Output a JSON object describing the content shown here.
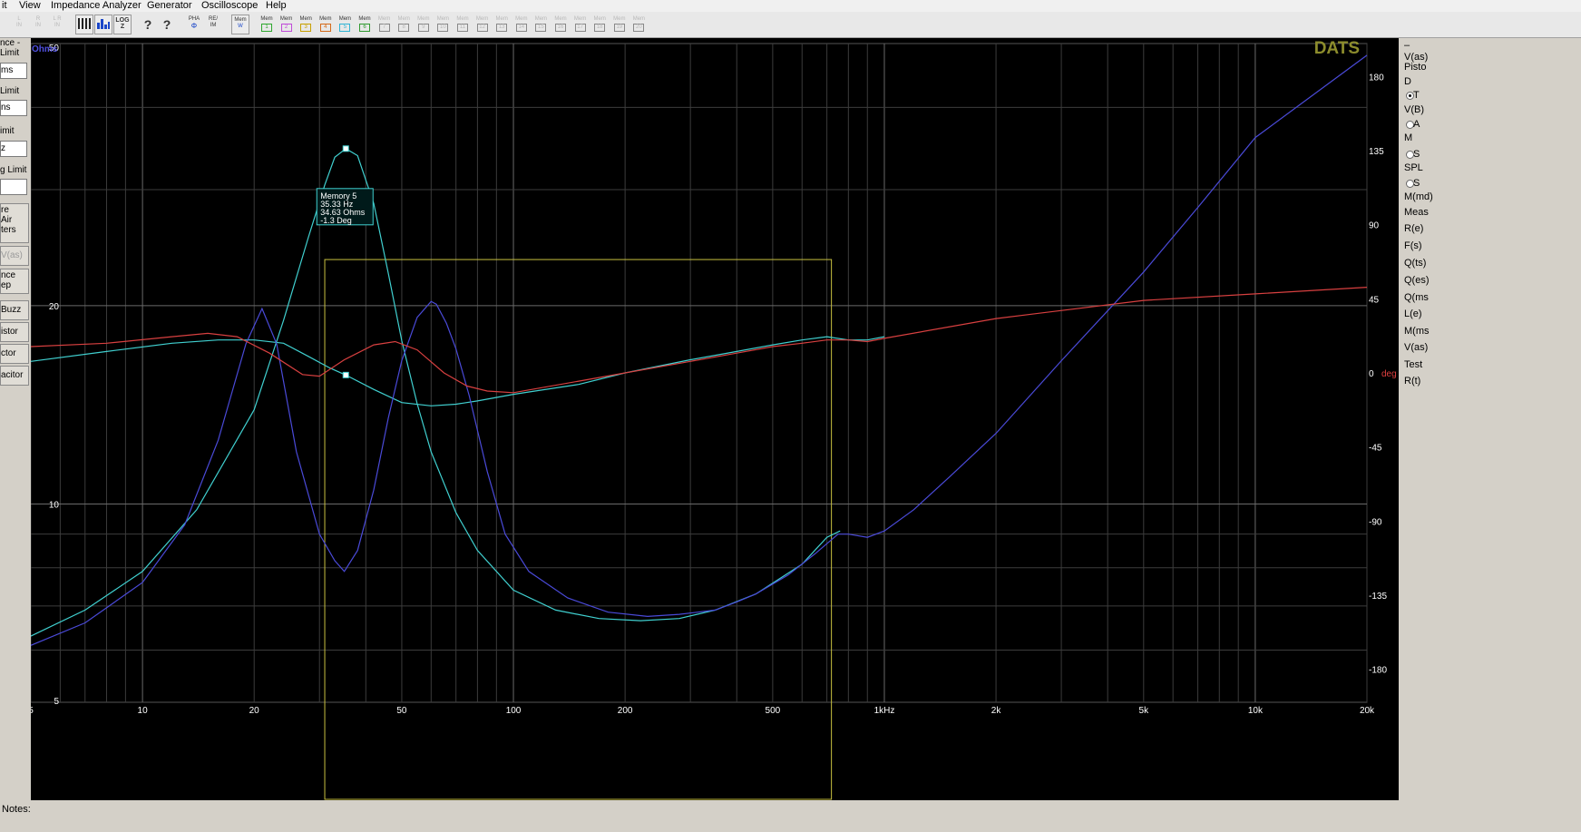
{
  "menu": [
    "it",
    "View",
    "Impedance Analyzer",
    "Generator",
    "Oscilloscope",
    "Help"
  ],
  "toolbar": {
    "channels": [
      {
        "t": "L",
        "b": "IN"
      },
      {
        "t": "R",
        "b": "IN"
      },
      {
        "t": "L R",
        "b": "IN"
      }
    ],
    "tools": [
      {
        "t": "LOG",
        "b": "Z"
      },
      {
        "t": "PHA",
        "b": "Φ"
      },
      {
        "t": "RE/",
        "b": "IM"
      },
      {
        "t": "Mem",
        "b": "W"
      }
    ],
    "mem_label": "Mem",
    "memories": [
      "1",
      "2",
      "3",
      "4",
      "5",
      "6",
      "7",
      "8",
      "9",
      "10",
      "11",
      "12",
      "13",
      "14",
      "15",
      "16",
      "17",
      "18",
      "19",
      "20"
    ]
  },
  "left_panel": {
    "labels": [
      "nce -",
      "Limit",
      "Limit",
      "imit",
      "g Limit"
    ],
    "boxes": [
      "ms",
      "ns",
      "z",
      ""
    ],
    "measure_lines": [
      "re",
      "Air",
      "ters"
    ],
    "buttons": [
      "V(as)",
      "nce",
      "ep",
      "Buzz",
      "istor",
      "ctor",
      "acitor"
    ]
  },
  "chart_data": {
    "type": "line",
    "brand": "DATS",
    "xscale": "log",
    "xlim": [
      5,
      20000
    ],
    "y_left": {
      "label": "Ohms",
      "scale": "log",
      "lim": [
        5,
        50
      ],
      "ticks": [
        5,
        10,
        20,
        50
      ]
    },
    "y_right": {
      "label": "deg",
      "lim": [
        -200,
        200
      ],
      "ticks": [
        180,
        135,
        90,
        45,
        0,
        -45,
        -90,
        -135,
        -180
      ]
    },
    "x_ticks": [
      {
        "v": 5,
        "label": "5"
      },
      {
        "v": 10,
        "label": "10"
      },
      {
        "v": 20,
        "label": "20"
      },
      {
        "v": 50,
        "label": "50"
      },
      {
        "v": 100,
        "label": "100"
      },
      {
        "v": 200,
        "label": "200"
      },
      {
        "v": 500,
        "label": "500"
      },
      {
        "v": 1000,
        "label": "1kHz"
      },
      {
        "v": 2000,
        "label": "2k"
      },
      {
        "v": 5000,
        "label": "5k"
      },
      {
        "v": 10000,
        "label": "10k"
      },
      {
        "v": 20000,
        "label": "20k"
      }
    ],
    "series": [
      {
        "color": "#40d0d0",
        "axis": "ohms",
        "x": [
          5,
          7,
          10,
          14,
          20,
          24,
          28,
          31,
          33,
          35.33,
          38,
          42,
          46,
          50,
          55,
          60,
          70,
          80,
          100,
          130,
          170,
          220,
          280,
          350,
          450,
          600,
          700,
          760
        ],
        "y": [
          6.3,
          6.9,
          7.9,
          9.8,
          13.9,
          19.0,
          25.4,
          30.5,
          33.6,
          34.63,
          33.8,
          28.6,
          22.4,
          17.7,
          14.2,
          12.0,
          9.7,
          8.5,
          7.4,
          6.9,
          6.7,
          6.65,
          6.7,
          6.9,
          7.3,
          8.1,
          8.9,
          9.1
        ]
      },
      {
        "color": "#40d0d0",
        "axis": "deg",
        "x": [
          5,
          8,
          12,
          16,
          20,
          24,
          28,
          32,
          35.33,
          42,
          50,
          60,
          70,
          80,
          100,
          150,
          200,
          300,
          400,
          500,
          600,
          700,
          800,
          900,
          1000
        ],
        "y": [
          7,
          13,
          18,
          20,
          20,
          18,
          10,
          3,
          -1.3,
          -10,
          -18,
          -20,
          -19,
          -17,
          -13,
          -7,
          0,
          8,
          13,
          17,
          20,
          22,
          20,
          20,
          22
        ]
      },
      {
        "color": "#4a4ad8",
        "axis": "ohms",
        "x": [
          5,
          7,
          10,
          13,
          16,
          19,
          21,
          23,
          26,
          30,
          33,
          35,
          38,
          42,
          46,
          50,
          55,
          60,
          62,
          66,
          70,
          76,
          85,
          95,
          110,
          140,
          180,
          230,
          280,
          350,
          400,
          450,
          550,
          650,
          750,
          800,
          900,
          1000,
          1200,
          1500,
          2000,
          3000,
          5000,
          7000,
          10000,
          20000
        ],
        "y": [
          6.1,
          6.6,
          7.6,
          9.3,
          12.5,
          17.5,
          19.8,
          17.5,
          12.0,
          9.0,
          8.2,
          7.9,
          8.5,
          10.5,
          13.5,
          16.5,
          19.2,
          20.3,
          20.1,
          18.8,
          17.2,
          14.6,
          11.2,
          9.0,
          7.9,
          7.2,
          6.85,
          6.75,
          6.8,
          6.9,
          7.1,
          7.3,
          7.8,
          8.4,
          9.0,
          9.0,
          8.9,
          9.1,
          9.8,
          11.0,
          12.8,
          16.5,
          22.5,
          28.2,
          36.0,
          48.0
        ]
      },
      {
        "color": "#d84040",
        "axis": "deg",
        "x": [
          5,
          8,
          12,
          15,
          18,
          22,
          27,
          30,
          35,
          42,
          48,
          55,
          65,
          75,
          85,
          100,
          150,
          200,
          300,
          400,
          500,
          600,
          700,
          800,
          900,
          1000,
          2000,
          5000,
          10000,
          20000
        ],
        "y": [
          16,
          18,
          22,
          24,
          22,
          12,
          -1,
          -2,
          8,
          17,
          19,
          14,
          0,
          -8,
          -11,
          -12,
          -5,
          0,
          7,
          12,
          16,
          18,
          20,
          20,
          19,
          21,
          33,
          44,
          48,
          52
        ]
      }
    ],
    "marker": {
      "label": "Memory 5",
      "freq": "35.33 Hz",
      "ohms": "34.63 Ohms",
      "deg": "-1.3 Deg",
      "x": 35.33,
      "y": 34.63,
      "deg_value": -1.3
    },
    "selection": {
      "x_start": 31,
      "x_end": 720,
      "y_top_ohms": 23.5
    }
  },
  "right_panel": {
    "items": [
      {
        "label": "–",
        "radio": null
      },
      {
        "label": "V(as)",
        "radio": null
      },
      {
        "label": "Pisto",
        "radio": null
      },
      {
        "label": "D",
        "radio": null
      },
      {
        "label": "T",
        "radio": "on"
      },
      {
        "label": "V(B)",
        "radio": null
      },
      {
        "label": "A",
        "radio": "off"
      },
      {
        "label": "M",
        "radio": null
      },
      {
        "label": "S",
        "radio": "off"
      },
      {
        "label": "SPL",
        "radio": null
      },
      {
        "label": "S",
        "radio": "off"
      },
      {
        "label": "M(md)",
        "radio": null
      },
      {
        "label": "Meas",
        "radio": null
      },
      {
        "label": "R(e)",
        "radio": null
      },
      {
        "label": "F(s)",
        "radio": null
      },
      {
        "label": "Q(ts)",
        "radio": null
      },
      {
        "label": "Q(es)",
        "radio": null
      },
      {
        "label": "Q(ms",
        "radio": null
      },
      {
        "label": "L(e)",
        "radio": null
      },
      {
        "label": "M(ms",
        "radio": null
      },
      {
        "label": "V(as)",
        "radio": null
      },
      {
        "label": "Test",
        "radio": null
      },
      {
        "label": "R(t)",
        "radio": null
      }
    ]
  },
  "notes": {
    "label": "Notes:",
    "value": ""
  }
}
